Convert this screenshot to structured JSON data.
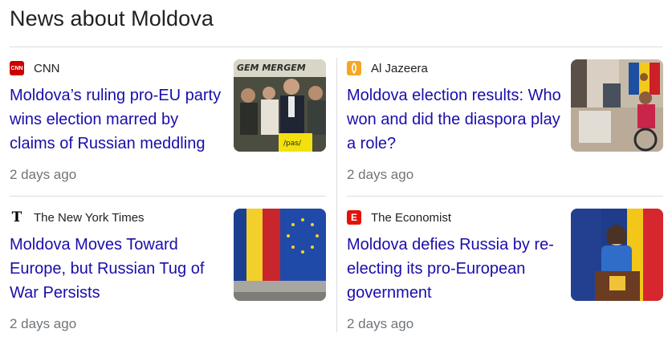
{
  "section_title": "News about Moldova",
  "articles": [
    {
      "publisher": "CNN",
      "logo_text": "CNN",
      "logo_color": "#cc0000",
      "headline": "Moldova’s ruling pro-EU party wins election marred by claims of Russian meddling",
      "time": "2 days ago",
      "thumb_icon": "press-conference-photo"
    },
    {
      "publisher": "Al Jazeera",
      "logo_text": "",
      "logo_color": "#f5a623",
      "headline": "Moldova election results: Who won and did the diaspora play a role?",
      "time": "2 days ago",
      "thumb_icon": "polling-station-photo"
    },
    {
      "publisher": "The New York Times",
      "logo_text": "T",
      "logo_color": "#000000",
      "headline": "Moldova Moves Toward Europe, but Russian Tug of War Persists",
      "time": "2 days ago",
      "thumb_icon": "flags-building-photo"
    },
    {
      "publisher": "The Economist",
      "logo_text": "E",
      "logo_color": "#e3120b",
      "headline": "Moldova defies Russia by re-electing its pro-European government",
      "time": "2 days ago",
      "thumb_icon": "president-speech-photo"
    }
  ]
}
